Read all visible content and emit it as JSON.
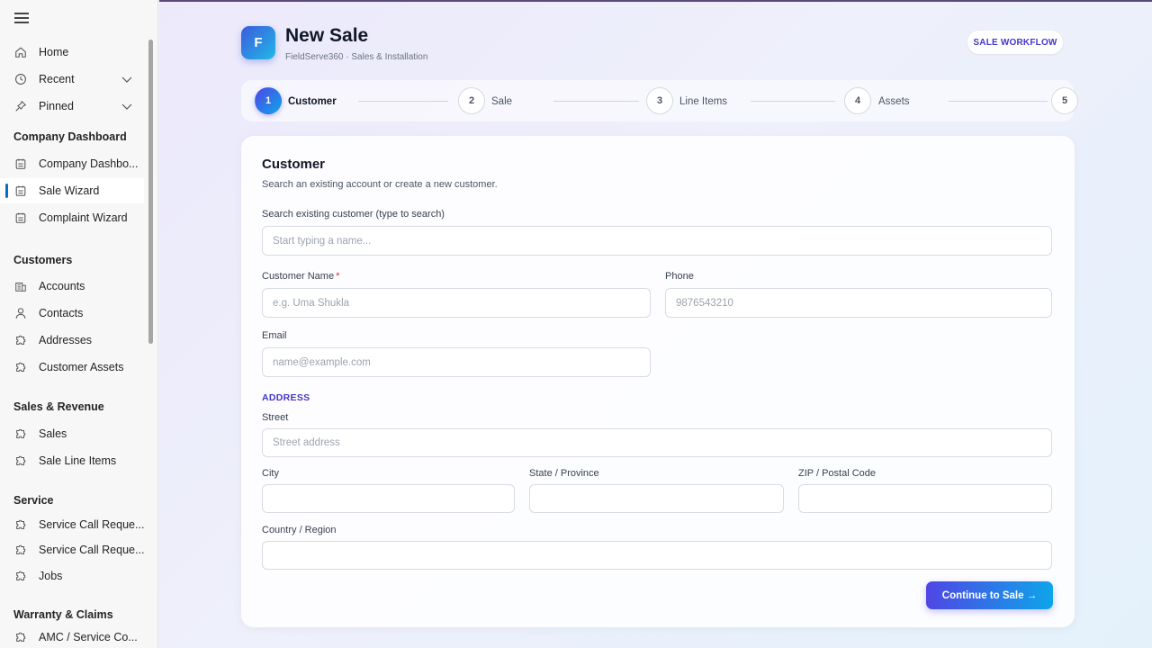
{
  "sidebar": {
    "items": [
      {
        "label": "Home",
        "icon": "home-icon"
      },
      {
        "label": "Recent",
        "icon": "clock-icon"
      },
      {
        "label": "Pinned",
        "icon": "pin-icon"
      },
      {
        "label": "Company Dashbo...",
        "icon": "dashboard-icon"
      },
      {
        "label": "Sale Wizard",
        "icon": "dashboard-icon"
      },
      {
        "label": "Complaint Wizard",
        "icon": "dashboard-icon"
      },
      {
        "label": "Accounts",
        "icon": "accounts-icon"
      },
      {
        "label": "Contacts",
        "icon": "person-icon"
      },
      {
        "label": "Addresses",
        "icon": "puzzle-icon"
      },
      {
        "label": "Customer Assets",
        "icon": "puzzle-icon"
      },
      {
        "label": "Sales",
        "icon": "puzzle-icon"
      },
      {
        "label": "Sale Line Items",
        "icon": "puzzle-icon"
      },
      {
        "label": "Service Call Reque...",
        "icon": "puzzle-icon"
      },
      {
        "label": "Service Call Reque...",
        "icon": "puzzle-icon"
      },
      {
        "label": "Jobs",
        "icon": "puzzle-icon"
      },
      {
        "label": "AMC / Service Co...",
        "icon": "puzzle-icon"
      }
    ],
    "sections": [
      "Company Dashboard",
      "Customers",
      "Sales & Revenue",
      "Service",
      "Warranty & Claims"
    ]
  },
  "header": {
    "logo_letter": "F",
    "title": "New Sale",
    "subtitle": "FieldServe360 · Sales & Installation",
    "badge": "SALE WORKFLOW"
  },
  "steps": [
    {
      "num": "1",
      "label": "Customer"
    },
    {
      "num": "2",
      "label": "Sale"
    },
    {
      "num": "3",
      "label": "Line Items"
    },
    {
      "num": "4",
      "label": "Assets"
    },
    {
      "num": "5",
      "label": ""
    }
  ],
  "form": {
    "title": "Customer",
    "subtitle": "Search an existing account or create a new customer.",
    "search_label": "Search existing customer (type to search)",
    "search_placeholder": "Start typing a name...",
    "name_label": "Customer Name",
    "required_mark": "*",
    "name_placeholder": "e.g. Uma Shukla",
    "phone_label": "Phone",
    "phone_placeholder": "9876543210",
    "email_label": "Email",
    "email_placeholder": "name@example.com",
    "address_heading": "ADDRESS",
    "street_label": "Street",
    "street_placeholder": "Street address",
    "city_label": "City",
    "state_label": "State / Province",
    "zip_label": "ZIP / Postal Code",
    "country_label": "Country / Region",
    "continue_label": "Continue to Sale →"
  },
  "colors": {
    "accent": "#4f46e5",
    "accent_end": "#0ea5e9",
    "required": "#dc2626",
    "active_nav_bar": "#0f6cbd"
  }
}
